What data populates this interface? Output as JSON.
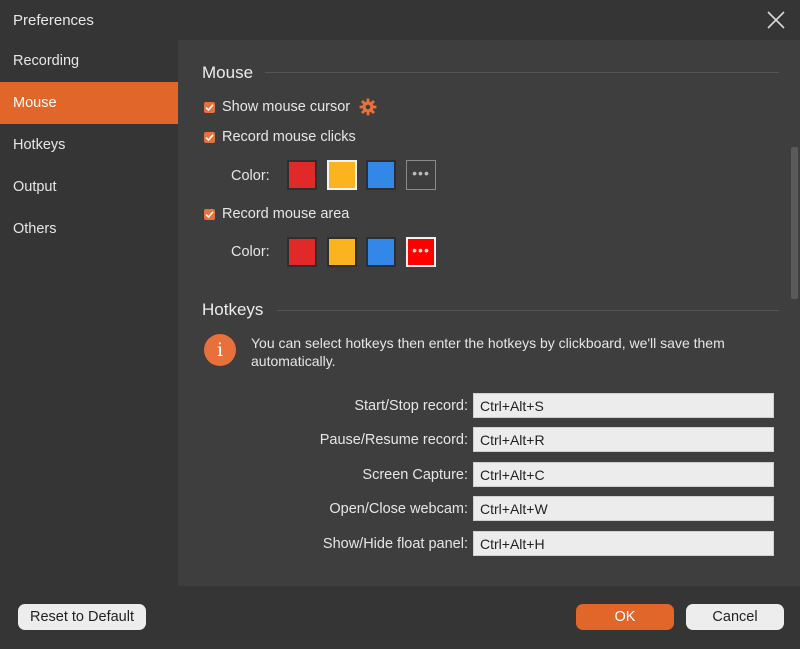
{
  "window": {
    "title": "Preferences"
  },
  "sidebar": {
    "items": [
      {
        "label": "Recording",
        "active": false
      },
      {
        "label": "Mouse",
        "active": true
      },
      {
        "label": "Hotkeys",
        "active": false
      },
      {
        "label": "Output",
        "active": false
      },
      {
        "label": "Others",
        "active": false
      }
    ]
  },
  "mouse": {
    "title": "Mouse",
    "show_cursor": {
      "label": "Show mouse cursor",
      "checked": true,
      "settings_icon": "gear-icon"
    },
    "record_clicks": {
      "label": "Record mouse clicks",
      "checked": true,
      "color_label": "Color:",
      "swatches": [
        "#e02a2a",
        "#fbb31f",
        "#3387e6"
      ],
      "selected": "#fbb31f",
      "more_icon": "more-dots-icon"
    },
    "record_area": {
      "label": "Record mouse area",
      "checked": true,
      "color_label": "Color:",
      "swatches": [
        "#e02a2a",
        "#fbb31f",
        "#3387e6"
      ],
      "custom_color": "#ff0000",
      "more_icon": "more-dots-icon"
    }
  },
  "hotkeys": {
    "title": "Hotkeys",
    "info_icon": "info-icon",
    "info_text": "You can select hotkeys then enter the hotkeys by clickboard, we'll save them automatically.",
    "rows": [
      {
        "label": "Start/Stop record:",
        "value": "Ctrl+Alt+S"
      },
      {
        "label": "Pause/Resume record:",
        "value": "Ctrl+Alt+R"
      },
      {
        "label": "Screen Capture:",
        "value": "Ctrl+Alt+C"
      },
      {
        "label": "Open/Close webcam:",
        "value": "Ctrl+Alt+W"
      },
      {
        "label": "Show/Hide float panel:",
        "value": "Ctrl+Alt+H"
      }
    ]
  },
  "footer": {
    "reset_label": "Reset to Default",
    "ok_label": "OK",
    "cancel_label": "Cancel"
  },
  "colors": {
    "accent": "#e0662a",
    "sidebar_bg": "#353535",
    "content_bg": "#3e3e3e"
  }
}
